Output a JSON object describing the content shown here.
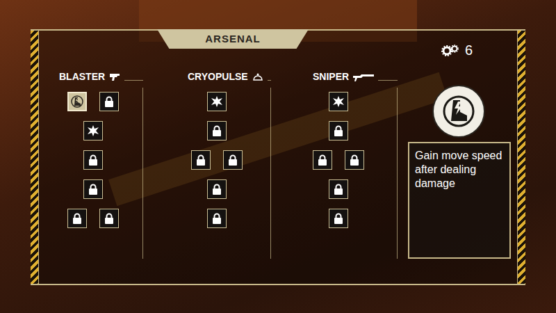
{
  "panel": {
    "title": "ARSENAL"
  },
  "points": "6",
  "trees": [
    {
      "name": "BLASTER",
      "rows": [
        [
          {
            "kind": "unlocked",
            "selected": true
          },
          {
            "kind": "locked",
            "selected": false
          }
        ],
        [
          {
            "kind": "unlocked",
            "selected": false
          }
        ],
        [
          {
            "kind": "locked",
            "selected": false
          }
        ],
        [
          {
            "kind": "locked",
            "selected": false
          }
        ],
        [
          {
            "kind": "locked",
            "selected": false
          },
          {
            "kind": "locked",
            "selected": false
          }
        ]
      ]
    },
    {
      "name": "CRYOPULSE",
      "rows": [
        [
          {
            "kind": "unlocked",
            "selected": false
          }
        ],
        [
          {
            "kind": "locked",
            "selected": false
          }
        ],
        [
          {
            "kind": "locked",
            "selected": false
          },
          {
            "kind": "locked",
            "selected": false
          }
        ],
        [
          {
            "kind": "locked",
            "selected": false
          }
        ],
        [
          {
            "kind": "locked",
            "selected": false
          }
        ]
      ]
    },
    {
      "name": "SNIPER",
      "rows": [
        [
          {
            "kind": "unlocked",
            "selected": false
          }
        ],
        [
          {
            "kind": "locked",
            "selected": false
          }
        ],
        [
          {
            "kind": "locked",
            "selected": false
          },
          {
            "kind": "locked",
            "selected": false
          }
        ],
        [
          {
            "kind": "locked",
            "selected": false
          }
        ],
        [
          {
            "kind": "locked",
            "selected": false
          }
        ]
      ]
    }
  ],
  "detail": {
    "description": "Gain move speed after dealing damage"
  }
}
